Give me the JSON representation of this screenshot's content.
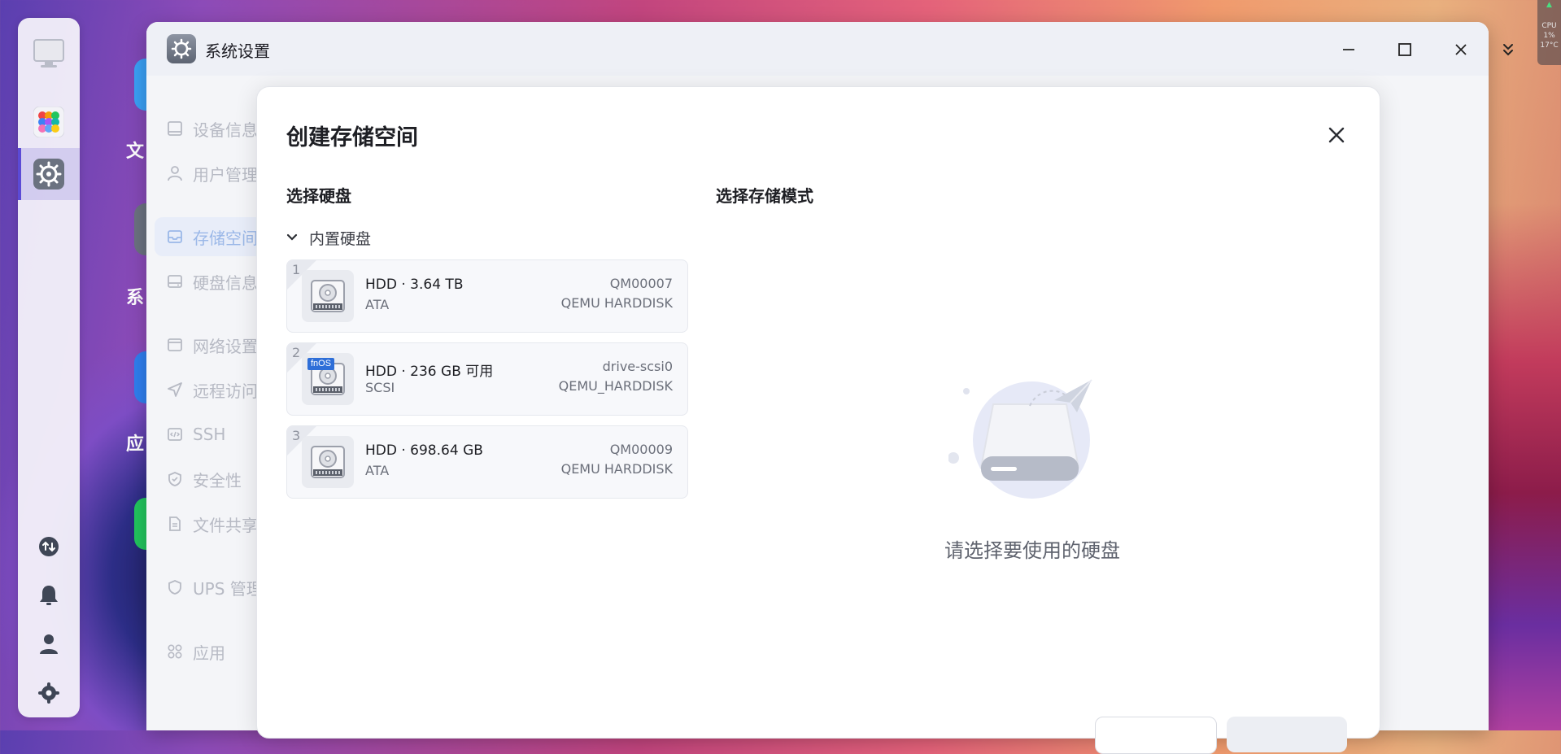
{
  "window": {
    "title": "系统设置"
  },
  "desktop": {
    "labels": [
      "文",
      "系",
      "应"
    ]
  },
  "sidebar": {
    "items": [
      {
        "label": "设备信息"
      },
      {
        "label": "用户管理"
      },
      {
        "label": "存储空间",
        "selected": true
      },
      {
        "label": "硬盘信息"
      },
      {
        "label": "网络设置"
      },
      {
        "label": "远程访问"
      },
      {
        "label": "SSH"
      },
      {
        "label": "安全性"
      },
      {
        "label": "文件共享"
      },
      {
        "label": "UPS 管理"
      },
      {
        "label": "应用"
      }
    ]
  },
  "dialog": {
    "title": "创建存储空间",
    "left_section_title": "选择硬盘",
    "right_section_title": "选择存储模式",
    "group_label": "内置硬盘",
    "empty_message": "请选择要使用的硬盘",
    "disks": [
      {
        "index": "1",
        "title": "HDD · 3.64 TB",
        "bus": "ATA",
        "serial": "QM00007",
        "model": "QEMU HARDDISK",
        "badge": ""
      },
      {
        "index": "2",
        "title": "HDD · 236 GB 可用",
        "bus": "SCSI",
        "serial": "drive-scsi0",
        "model": "QEMU_HARDDISK",
        "badge": "fnOS"
      },
      {
        "index": "3",
        "title": "HDD · 698.64 GB",
        "bus": "ATA",
        "serial": "QM00009",
        "model": "QEMU HARDDISK",
        "badge": ""
      }
    ]
  },
  "tray": {
    "cpu_label": "CPU",
    "cpu_value": "1%",
    "temp": "17°C"
  },
  "colors": {
    "accent": "#5b4ad6",
    "selected_nav": "#9bb8e8",
    "badge": "#2f6fd8"
  }
}
